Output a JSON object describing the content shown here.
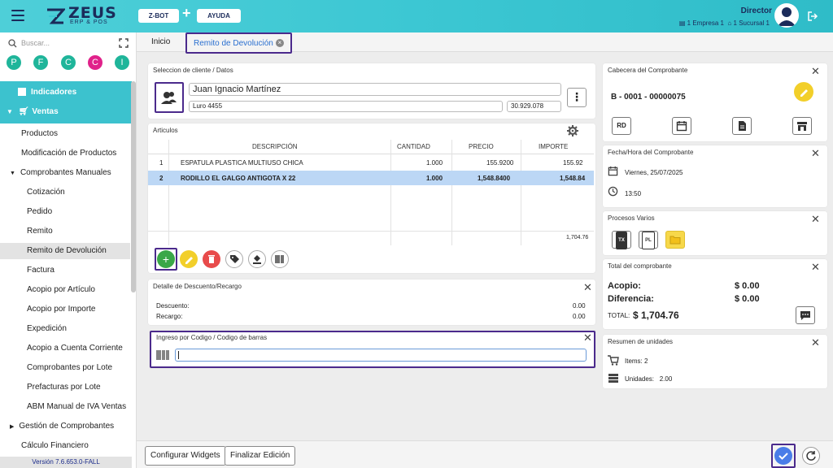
{
  "app": {
    "logo_text": "ZEUS",
    "logo_sub": "ERP & POS",
    "btn_zbot": "Z-BOT",
    "btn_ayuda": "AYUDA",
    "user_role": "Director",
    "empresa": "1 Empresa 1",
    "sucursal": "1 Sucursal 1"
  },
  "sidebar": {
    "search_placeholder": "Buscar...",
    "shortcuts": [
      "P",
      "F",
      "C",
      "C",
      "I"
    ],
    "shortcut_colors": [
      "#1fb59a",
      "#1fb59a",
      "#1fb59a",
      "#e0218a",
      "#1fb59a"
    ],
    "indicadores": "Indicadores",
    "ventas": "Ventas",
    "items": [
      "Productos",
      "Modificación de Productos",
      "Comprobantes Manuales",
      "Cotización",
      "Pedido",
      "Remito",
      "Remito de Devolución",
      "Factura",
      "Acopio por Artículo",
      "Acopio por Importe",
      "Expedición",
      "Acopio a Cuenta Corriente",
      "Comprobantes por Lote",
      "Prefacturas por Lote",
      "ABM Manual de IVA Ventas",
      "Gestión de Comprobantes",
      "Cálculo Financiero"
    ],
    "version": "Versión 7.6.653.0-FALL"
  },
  "tabs": {
    "inicio": "Inicio",
    "active": "Remito de Devolución"
  },
  "cliente": {
    "title": "Seleccion de cliente / Datos",
    "name": "Juan Ignacio Martínez",
    "address": "Luro 4455",
    "cuit": "30.929.078"
  },
  "articulos": {
    "title": "Articulos",
    "headers": [
      "DESCRIPCIÓN",
      "CANTIDAD",
      "PRECIO",
      "IMPORTE"
    ],
    "rows": [
      {
        "n": "1",
        "desc": "ESPATULA PLASTICA MULTIUSO CHICA",
        "cant": "1.000",
        "precio": "155.9200",
        "importe": "155.92"
      },
      {
        "n": "2",
        "desc": "RODILLO EL GALGO ANTIGOTA X 22",
        "cant": "1.000",
        "precio": "1,548.8400",
        "importe": "1,548.84"
      }
    ],
    "total": "1,704.76"
  },
  "descuento": {
    "title": "Detalle de Descuento/Recargo",
    "descuento_label": "Descuento:",
    "descuento_value": "0.00",
    "recargo_label": "Recargo:",
    "recargo_value": "0.00"
  },
  "ingreso": {
    "title": "Ingreso por Codigo / Codigo de barras",
    "value": ""
  },
  "cabecera": {
    "title": "Cabecera del Comprobante",
    "numero": "B - 0001 - 00000075",
    "rd": "RD"
  },
  "fecha": {
    "title": "Fecha/Hora del Comprobante",
    "fecha": "Viernes, 25/07/2025",
    "hora": "13:50"
  },
  "procesos": {
    "title": "Procesos Varios",
    "tx": "TX",
    "pl": "PL"
  },
  "total": {
    "title": "Total del comprobante",
    "acopio_label": "Acopio:",
    "acopio_value": "$ 0.00",
    "diferencia_label": "Diferencia:",
    "diferencia_value": "$ 0.00",
    "total_label": "TOTAL:",
    "total_value": "$ 1,704.76"
  },
  "unidades": {
    "title": "Resumen de unidades",
    "items": "Items: 2",
    "unidades": "Unidades:   2.00"
  },
  "bottom": {
    "configurar": "Configurar Widgets",
    "finalizar": "Finalizar Edición"
  }
}
